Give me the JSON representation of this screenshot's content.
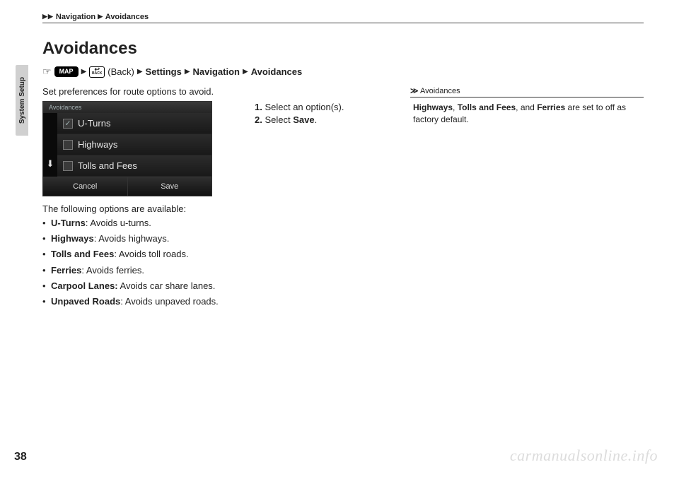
{
  "breadcrumb": {
    "nav": "Navigation",
    "sub": "Avoidances"
  },
  "side_tab": "System Setup",
  "title": "Avoidances",
  "path": {
    "map": "MAP",
    "back_btn": "BACK",
    "back_label": "(Back)",
    "settings": "Settings",
    "navigation": "Navigation",
    "avoidances": "Avoidances"
  },
  "intro": "Set preferences for route options to avoid.",
  "screenshot": {
    "header": "Avoidances",
    "items": [
      {
        "label": "U-Turns",
        "checked": true
      },
      {
        "label": "Highways",
        "checked": false
      },
      {
        "label": "Tolls and Fees",
        "checked": false
      }
    ],
    "cancel": "Cancel",
    "save": "Save"
  },
  "options_intro": "The following options are available:",
  "options": [
    {
      "name": "U-Turns",
      "desc": ": Avoids u-turns."
    },
    {
      "name": "Highways",
      "desc": ": Avoids highways."
    },
    {
      "name": "Tolls and Fees",
      "desc": ": Avoids toll roads."
    },
    {
      "name": "Ferries",
      "desc": ": Avoids ferries."
    },
    {
      "name": "Carpool Lanes:",
      "desc": " Avoids car share lanes."
    },
    {
      "name": "Unpaved Roads",
      "desc": ": Avoids unpaved roads."
    }
  ],
  "steps": {
    "s1_num": "1.",
    "s1": " Select an option(s).",
    "s2_num": "2.",
    "s2a": " Select ",
    "s2b": "Save",
    "s2c": "."
  },
  "note": {
    "head": "Avoidances",
    "b1": "Highways",
    "t1": ", ",
    "b2": "Tolls and Fees",
    "t2": ", and ",
    "b3": "Ferries",
    "t3": " are set to off as factory default."
  },
  "page_num": "38",
  "watermark": "carmanualsonline.info"
}
